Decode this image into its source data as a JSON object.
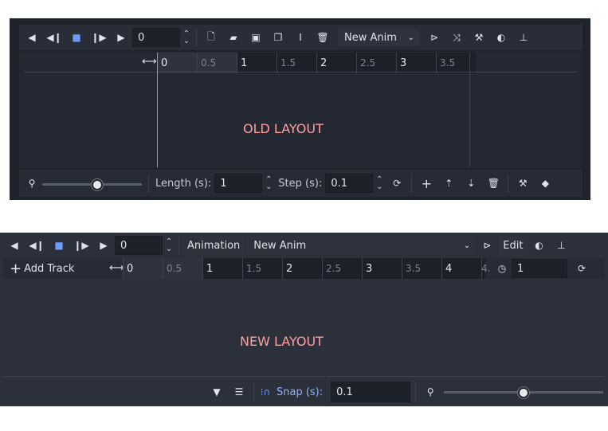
{
  "old_layout": {
    "toolbar": {
      "icons": [
        "play-backwards-icon",
        "step-back-icon",
        "stop-icon",
        "step-forward-icon",
        "play-icon"
      ],
      "time_value": "0",
      "file_icons": [
        "new-animation-icon",
        "load-animation-icon",
        "save-animation-icon",
        "duplicate-animation-icon",
        "rename-icon",
        "delete-icon"
      ],
      "animation_select": "New Anim",
      "right_icons": [
        "autoplay-icon",
        "blend-icon",
        "tools-icon",
        "onion-skin-icon",
        "pin-icon"
      ]
    },
    "timeline": {
      "ticks": [
        "0",
        "0.5",
        "1",
        "1.5",
        "2",
        "2.5",
        "3",
        "3.5"
      ]
    },
    "canvas_label": "OLD LAYOUT",
    "bottom": {
      "length_label": "Length (s):",
      "length_value": "1",
      "step_label": "Step (s):",
      "step_value": "0.1",
      "zoom_value": 0.55
    }
  },
  "new_layout": {
    "toolbar": {
      "time_value": "0",
      "animation_button": "Animation",
      "animation_select": "New Anim",
      "edit_button": "Edit"
    },
    "track_bar": {
      "add_track": "Add Track",
      "ticks": [
        "0",
        "0.5",
        "1",
        "1.5",
        "2",
        "2.5",
        "3",
        "3.5",
        "4",
        "4."
      ],
      "length_value": "1"
    },
    "canvas_label": "NEW LAYOUT",
    "bottom": {
      "snap_label": "Snap (s):",
      "snap_value": "0.1",
      "zoom_value": 0.5
    }
  },
  "colors": {
    "panel": "#20252f",
    "accent": "#6f9bff",
    "label_red": "#ff9f9f"
  }
}
